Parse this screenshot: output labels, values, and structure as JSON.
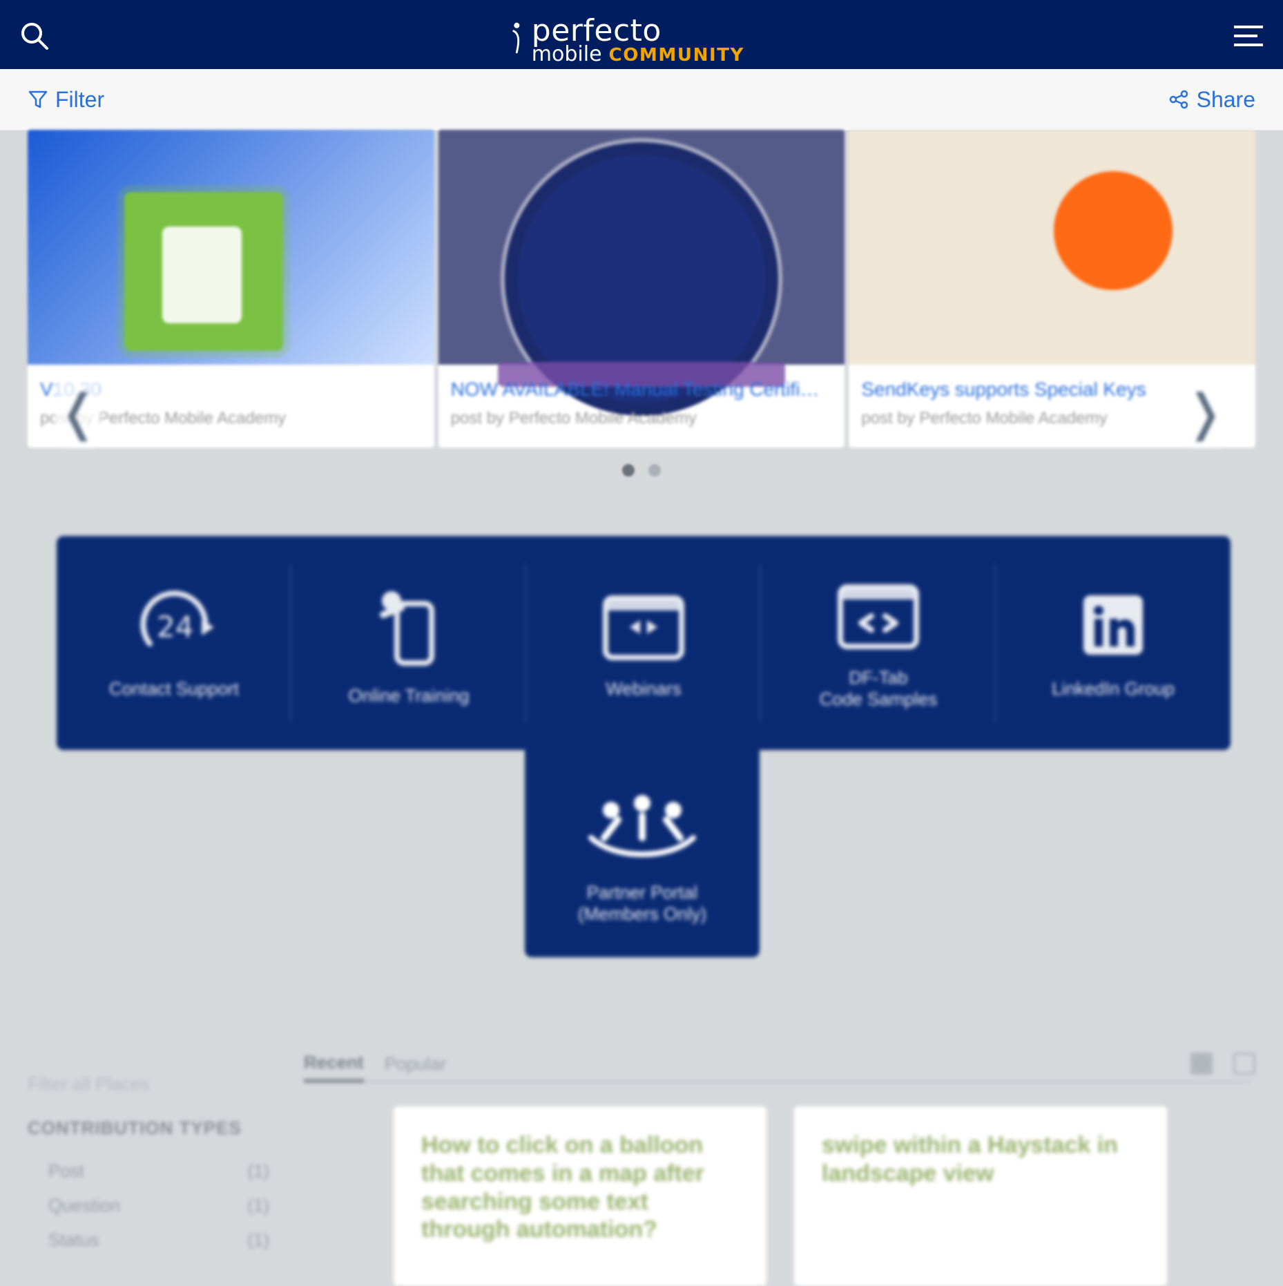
{
  "header": {
    "search_icon": "search-icon",
    "menu_icon": "hamburger-menu-icon",
    "logo": {
      "perfecto": "perfecto",
      "mobile": "mobile",
      "community": "COMMUNITY"
    }
  },
  "toolbar": {
    "filter_label": "Filter",
    "share_label": "Share"
  },
  "carousel": {
    "items": [
      {
        "title": "V10.30",
        "byline": "post by Perfecto Mobile Academy"
      },
      {
        "title": "NOW AVAILABLE! Manual Testing Certifi…",
        "byline": "post by Perfecto Mobile Academy"
      },
      {
        "title": "SendKeys supports Special Keys",
        "byline": "post by Perfecto Mobile Academy"
      }
    ],
    "left_arrow": "❬",
    "right_arrow": "❭"
  },
  "quick_links": {
    "tiles": [
      {
        "label": "Contact Support"
      },
      {
        "label": "Online Training"
      },
      {
        "label": "Webinars"
      },
      {
        "label": "DF-Tab\nCode Samples"
      },
      {
        "label": "LinkedIn Group"
      }
    ],
    "partner": {
      "label": "Partner Portal\n(Members Only)"
    }
  },
  "sidebar": {
    "search_placeholder": "Filter all Places",
    "contrib_title": "CONTRIBUTION TYPES",
    "rows": [
      {
        "label": "Post",
        "count": "(1)"
      },
      {
        "label": "Question",
        "count": "(1)"
      },
      {
        "label": "Status",
        "count": "(1)"
      }
    ]
  },
  "feed": {
    "tabs": [
      "Recent",
      "Popular"
    ],
    "cards": [
      {
        "title": "How to click on a balloon that comes in a map after searching some text through automation?"
      },
      {
        "title": "swipe within a Haystack in landscape view"
      }
    ]
  }
}
